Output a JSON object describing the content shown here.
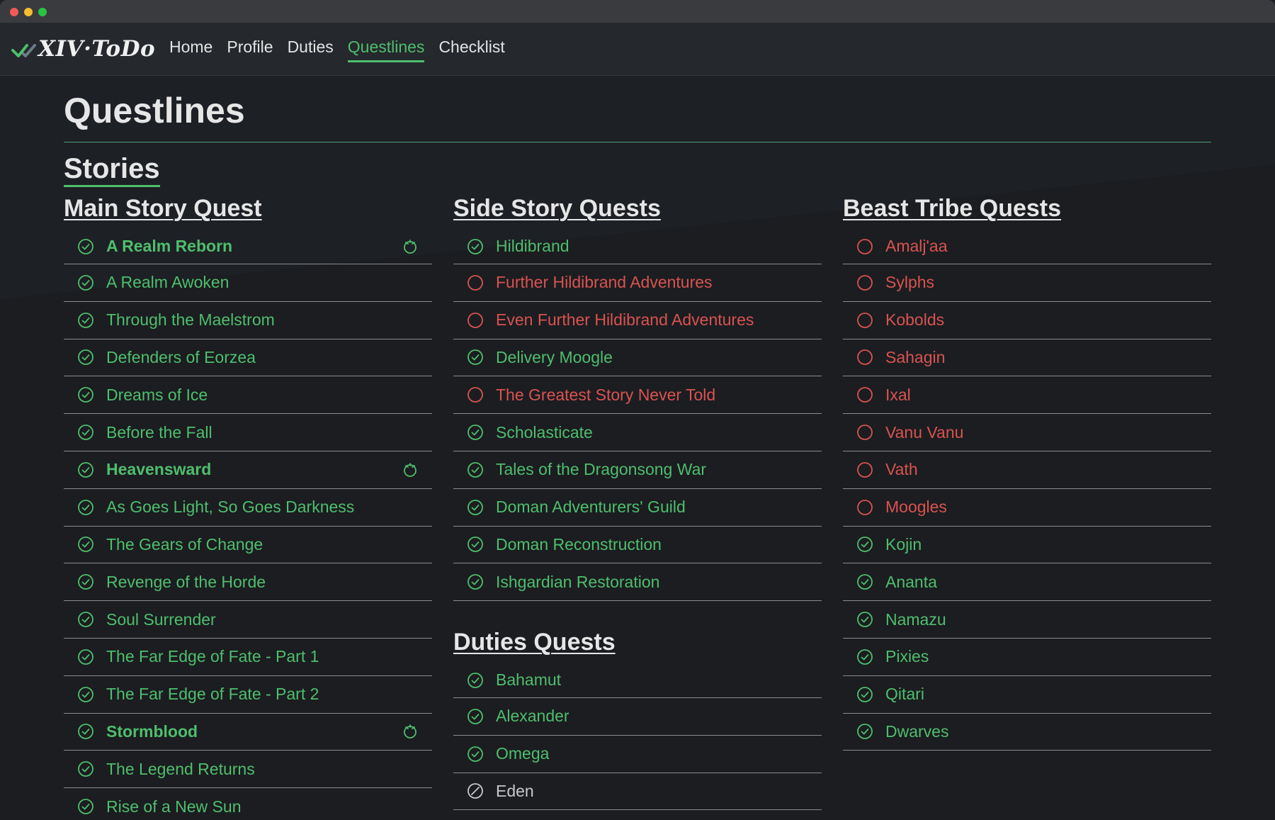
{
  "app": {
    "brand": "XIV·ToDo",
    "nav": [
      {
        "label": "Home",
        "active": false
      },
      {
        "label": "Profile",
        "active": false
      },
      {
        "label": "Duties",
        "active": false
      },
      {
        "label": "Questlines",
        "active": true
      },
      {
        "label": "Checklist",
        "active": false
      }
    ]
  },
  "page": {
    "title": "Questlines",
    "section": "Stories"
  },
  "colors": {
    "accent": "#4fbe6c",
    "incomplete": "#d9534f",
    "background": "#1d2025"
  },
  "groups": {
    "main_story": {
      "title": "Main Story Quest",
      "items": [
        {
          "label": "A Realm Reborn",
          "status": "done",
          "expansion": true
        },
        {
          "label": "A Realm Awoken",
          "status": "done"
        },
        {
          "label": "Through the Maelstrom",
          "status": "done"
        },
        {
          "label": "Defenders of Eorzea",
          "status": "done"
        },
        {
          "label": "Dreams of Ice",
          "status": "done"
        },
        {
          "label": "Before the Fall",
          "status": "done"
        },
        {
          "label": "Heavensward",
          "status": "done",
          "expansion": true
        },
        {
          "label": "As Goes Light, So Goes Darkness",
          "status": "done"
        },
        {
          "label": "The Gears of Change",
          "status": "done"
        },
        {
          "label": "Revenge of the Horde",
          "status": "done"
        },
        {
          "label": "Soul Surrender",
          "status": "done"
        },
        {
          "label": "The Far Edge of Fate - Part 1",
          "status": "done"
        },
        {
          "label": "The Far Edge of Fate - Part 2",
          "status": "done"
        },
        {
          "label": "Stormblood",
          "status": "done",
          "expansion": true
        },
        {
          "label": "The Legend Returns",
          "status": "done"
        },
        {
          "label": "Rise of a New Sun",
          "status": "done"
        }
      ]
    },
    "side_story": {
      "title": "Side Story Quests",
      "items": [
        {
          "label": "Hildibrand",
          "status": "done"
        },
        {
          "label": "Further Hildibrand Adventures",
          "status": "todo"
        },
        {
          "label": "Even Further Hildibrand Adventures",
          "status": "todo"
        },
        {
          "label": "Delivery Moogle",
          "status": "done"
        },
        {
          "label": "The Greatest Story Never Told",
          "status": "todo"
        },
        {
          "label": "Scholasticate",
          "status": "done"
        },
        {
          "label": "Tales of the Dragonsong War",
          "status": "done"
        },
        {
          "label": "Doman Adventurers' Guild",
          "status": "done"
        },
        {
          "label": "Doman Reconstruction",
          "status": "done"
        },
        {
          "label": "Ishgardian Restoration",
          "status": "done"
        }
      ]
    },
    "duties": {
      "title": "Duties Quests",
      "items": [
        {
          "label": "Bahamut",
          "status": "done"
        },
        {
          "label": "Alexander",
          "status": "done"
        },
        {
          "label": "Omega",
          "status": "done"
        },
        {
          "label": "Eden",
          "status": "na"
        }
      ]
    },
    "beast_tribe": {
      "title": "Beast Tribe Quests",
      "items": [
        {
          "label": "Amalj'aa",
          "status": "todo"
        },
        {
          "label": "Sylphs",
          "status": "todo"
        },
        {
          "label": "Kobolds",
          "status": "todo"
        },
        {
          "label": "Sahagin",
          "status": "todo"
        },
        {
          "label": "Ixal",
          "status": "todo"
        },
        {
          "label": "Vanu Vanu",
          "status": "todo"
        },
        {
          "label": "Vath",
          "status": "todo"
        },
        {
          "label": "Moogles",
          "status": "todo"
        },
        {
          "label": "Kojin",
          "status": "done"
        },
        {
          "label": "Ananta",
          "status": "done"
        },
        {
          "label": "Namazu",
          "status": "done"
        },
        {
          "label": "Pixies",
          "status": "done"
        },
        {
          "label": "Qitari",
          "status": "done"
        },
        {
          "label": "Dwarves",
          "status": "done"
        }
      ]
    }
  }
}
